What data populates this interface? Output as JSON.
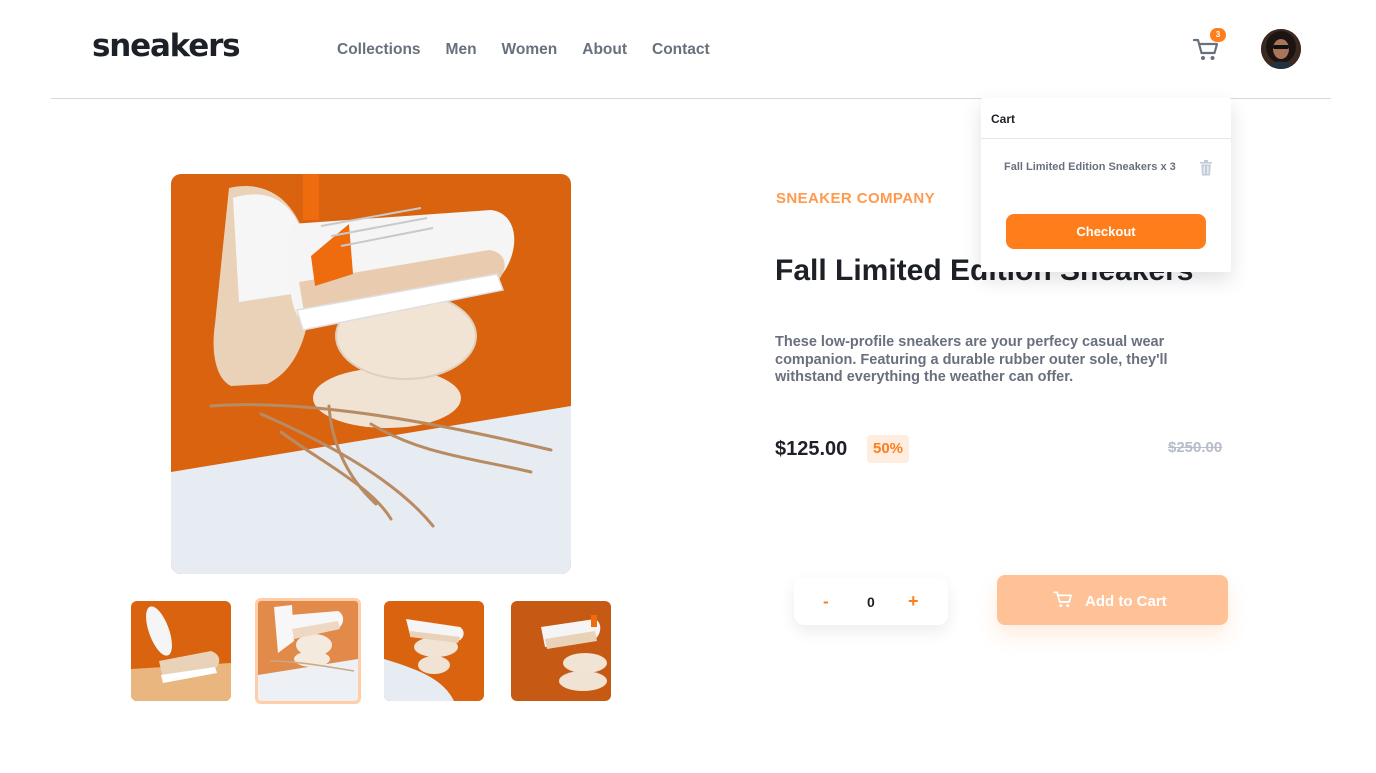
{
  "header": {
    "logo": "sneakers",
    "nav": [
      "Collections",
      "Men",
      "Women",
      "About",
      "Contact"
    ],
    "cart_count": "3"
  },
  "cart": {
    "title": "Cart",
    "item": "Fall Limited Edition Sneakers x 3",
    "checkout_label": "Checkout"
  },
  "product": {
    "company": "SNEAKER COMPANY",
    "title": "Fall Limited Edition Sneakers",
    "description": "These low-profile sneakers are your perfecy casual wear companion. Featuring a durable rubber outer sole, they'll withstand everything the weather can offer.",
    "price": "$125.00",
    "discount": "50%",
    "old_price": "$250.00"
  },
  "quantity": {
    "minus": "-",
    "value": "0",
    "plus": "+"
  },
  "add_to_cart": {
    "label": "Add to Cart"
  },
  "colors": {
    "accent": "#ff7e1b",
    "pale_accent": "#ffede0",
    "text_dark": "#1d2026",
    "text_gray": "#69707d"
  }
}
